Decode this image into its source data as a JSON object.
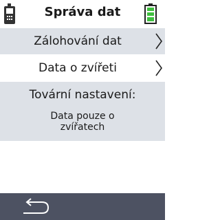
{
  "header": {
    "title": "Správa dat",
    "device_icon": "handheld-reader-icon",
    "battery_icon": "battery-full-icon",
    "battery_color": "#3fbf3f"
  },
  "menu": [
    {
      "label": "Zálohování dat",
      "icon": "chevron-right-icon"
    },
    {
      "label": "Data o zvířeti",
      "icon": "chevron-right-icon"
    }
  ],
  "factory": {
    "title": "Tovární nastavení:",
    "subtitle": "Data pouze o zvířatech"
  },
  "footer": {
    "back_icon": "back-arrow-icon",
    "background": "#4d5262"
  }
}
